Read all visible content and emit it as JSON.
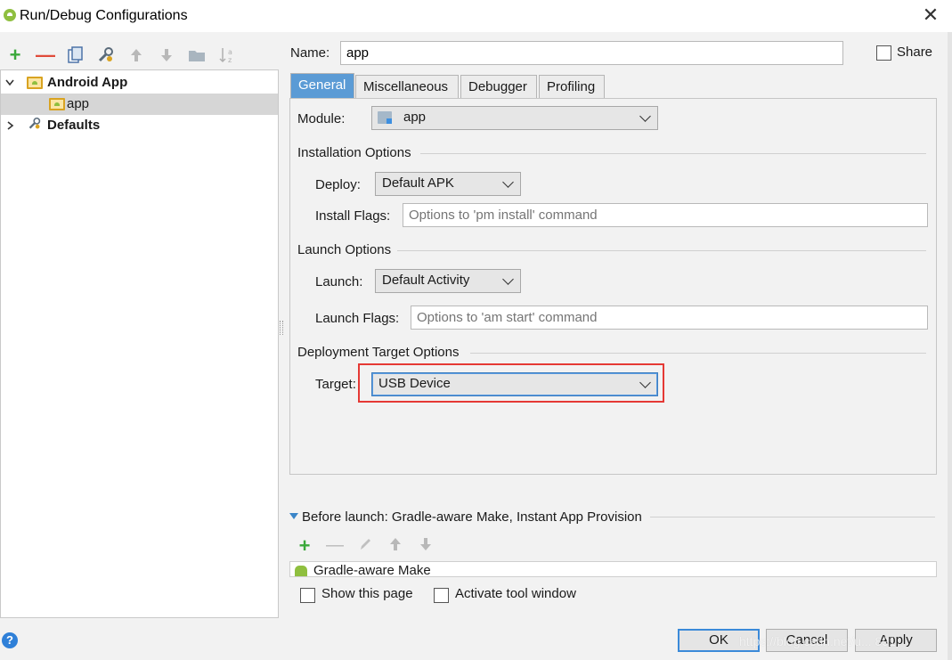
{
  "window": {
    "title": "Run/Debug Configurations"
  },
  "toolbar": {
    "icons": [
      "add-icon",
      "remove-icon",
      "copy-icon",
      "wrench-icon",
      "up-icon",
      "down-icon",
      "folder-icon",
      "sort-icon"
    ]
  },
  "tree": {
    "items": [
      {
        "label": "Android App",
        "expanded": true
      },
      {
        "label": "app",
        "selected": true
      },
      {
        "label": "Defaults",
        "expanded": false
      }
    ]
  },
  "name": {
    "label": "Name:",
    "value": "app"
  },
  "share": {
    "label": "Share",
    "checked": false
  },
  "tabs": [
    {
      "label": "General",
      "active": true
    },
    {
      "label": "Miscellaneous"
    },
    {
      "label": "Debugger"
    },
    {
      "label": "Profiling"
    }
  ],
  "general": {
    "module_label": "Module:",
    "module_value": "app",
    "installation_title": "Installation Options",
    "deploy_label": "Deploy:",
    "deploy_value": "Default APK",
    "install_flags_label": "Install Flags:",
    "install_flags_placeholder": "Options to 'pm install' command",
    "launch_title": "Launch Options",
    "launch_label": "Launch:",
    "launch_value": "Default Activity",
    "launch_flags_label": "Launch Flags:",
    "launch_flags_placeholder": "Options to 'am start' command",
    "deployment_title": "Deployment Target Options",
    "target_label": "Target:",
    "target_value": "USB Device"
  },
  "before_launch": {
    "title": "Before launch: Gradle-aware Make, Instant App Provision",
    "items": [
      "Gradle-aware Make"
    ]
  },
  "options": {
    "show_page_label": "Show this page",
    "activate_tool_label": "Activate tool window"
  },
  "buttons": {
    "ok": "OK",
    "cancel": "Cancel",
    "apply": "Apply"
  },
  "watermark": "https://blog.csdn.net/u... 891",
  "colors": {
    "accent": "#5b9bd5",
    "highlight": "#e53935",
    "add": "#3aa83a",
    "remove": "#e04b3a"
  }
}
